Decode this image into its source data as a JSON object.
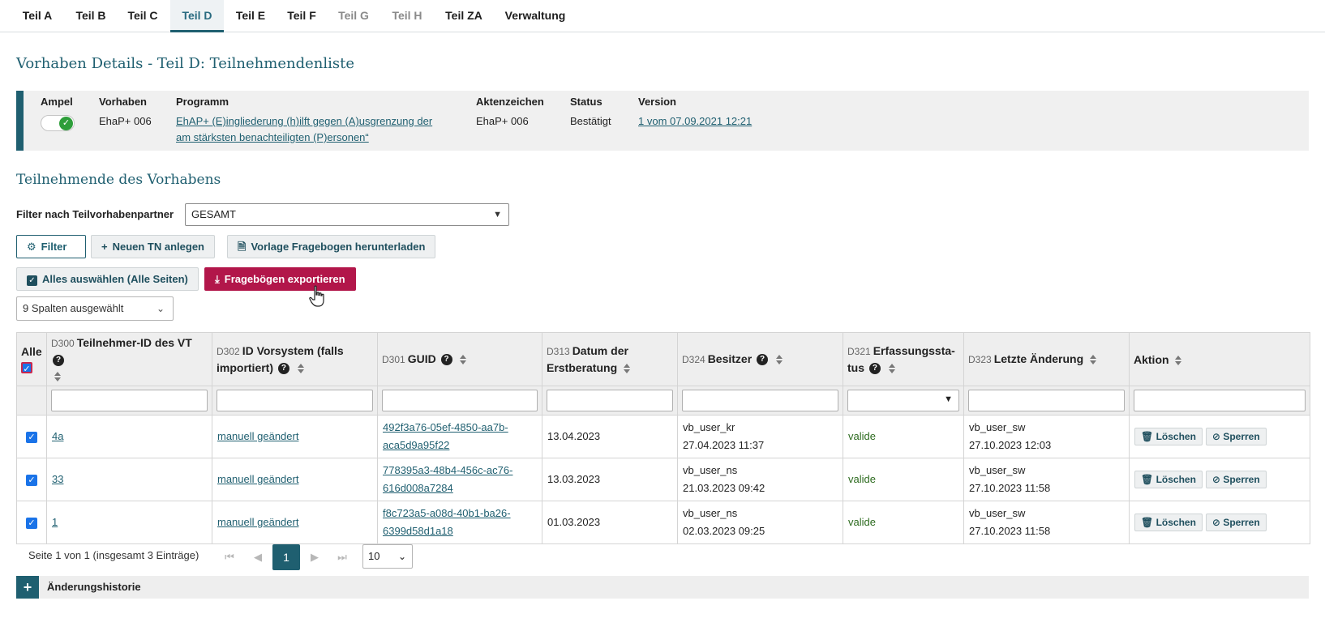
{
  "tabs": [
    "Teil A",
    "Teil B",
    "Teil C",
    "Teil D",
    "Teil E",
    "Teil F",
    "Teil G",
    "Teil H",
    "Teil ZA",
    "Verwaltung"
  ],
  "active_tab": "Teil D",
  "page_title": "Vorhaben Details - Teil D: Teilnehmendenliste",
  "info": {
    "headers": {
      "ampel": "Ampel",
      "vorhaben": "Vorhaben",
      "programm": "Programm",
      "aktenzeichen": "Aktenzeichen",
      "status": "Status",
      "version": "Version"
    },
    "vorhaben": "EhaP+ 006",
    "programm_line1": "EhAP+ (E)ingliederung (h)ilft gegen (A)usgrenzung der",
    "programm_line2": "am stärksten benachteiligten (P)ersonen“",
    "aktenzeichen": "EhaP+ 006",
    "status": "Bestätigt",
    "version": "1 vom 07.09.2021 12:21"
  },
  "section_title": "Teilnehmende des Vorhabens",
  "filter": {
    "label": "Filter nach Teilvorhabenpartner",
    "selected": "GESAMT"
  },
  "buttons": {
    "filter": "Filter",
    "new_tn": "Neuen TN anlegen",
    "download_template": "Vorlage Fragebogen herunterladen",
    "select_all": "Alles auswählen (Alle Seiten)",
    "export": "Fragebögen exportieren"
  },
  "columns_select": "9 Spalten ausgewählt",
  "table": {
    "headers": {
      "all": "Alle",
      "c1_code": "D300",
      "c1": "Teilnehmer-ID des VT",
      "c2_code": "D302",
      "c2a": "ID Vorsystem (falls",
      "c2b": "importiert)",
      "c3_code": "D301",
      "c3": "GUID",
      "c4_code": "D313",
      "c4a": "Datum der",
      "c4b": "Erstberatung",
      "c5_code": "D324",
      "c5": "Besitzer",
      "c6_code": "D321",
      "c6a": "Erfassungssta-",
      "c6b": "tus",
      "c7_code": "D323",
      "c7": "Letzte Änderung",
      "c8": "Aktion"
    },
    "rows": [
      {
        "id": "4a",
        "vorsystem": "manuell geändert",
        "guid1": "492f3a76-05ef-4850-aa7b-",
        "guid2": "aca5d9a95f22",
        "datum": "13.04.2023",
        "besitzer": "vb_user_kr",
        "besitzer_date": "27.04.2023 11:37",
        "status": "valide",
        "changed_by": "vb_user_sw",
        "changed_at": "27.10.2023 12:03"
      },
      {
        "id": "33",
        "vorsystem": "manuell geändert",
        "guid1": "778395a3-48b4-456c-ac76-",
        "guid2": "616d008a7284",
        "datum": "13.03.2023",
        "besitzer": "vb_user_ns",
        "besitzer_date": "21.03.2023 09:42",
        "status": "valide",
        "changed_by": "vb_user_sw",
        "changed_at": "27.10.2023 11:58"
      },
      {
        "id": "1",
        "vorsystem": "manuell geändert",
        "guid1": "f8c723a5-a08d-40b1-ba26-",
        "guid2": "6399d58d1a18",
        "datum": "01.03.2023",
        "besitzer": "vb_user_ns",
        "besitzer_date": "02.03.2023 09:25",
        "status": "valide",
        "changed_by": "vb_user_sw",
        "changed_at": "27.10.2023 11:58"
      }
    ],
    "action_delete": "Löschen",
    "action_lock": "Sperren"
  },
  "pagination": {
    "info": "Seite 1 von 1 (insgesamt 3 Einträge)",
    "current": "1",
    "page_size": "10"
  },
  "history_label": "Änderungshistorie",
  "colors": {
    "accent": "#1f5f70",
    "primary_button": "#b2164a",
    "valid": "#2d6b1f"
  }
}
